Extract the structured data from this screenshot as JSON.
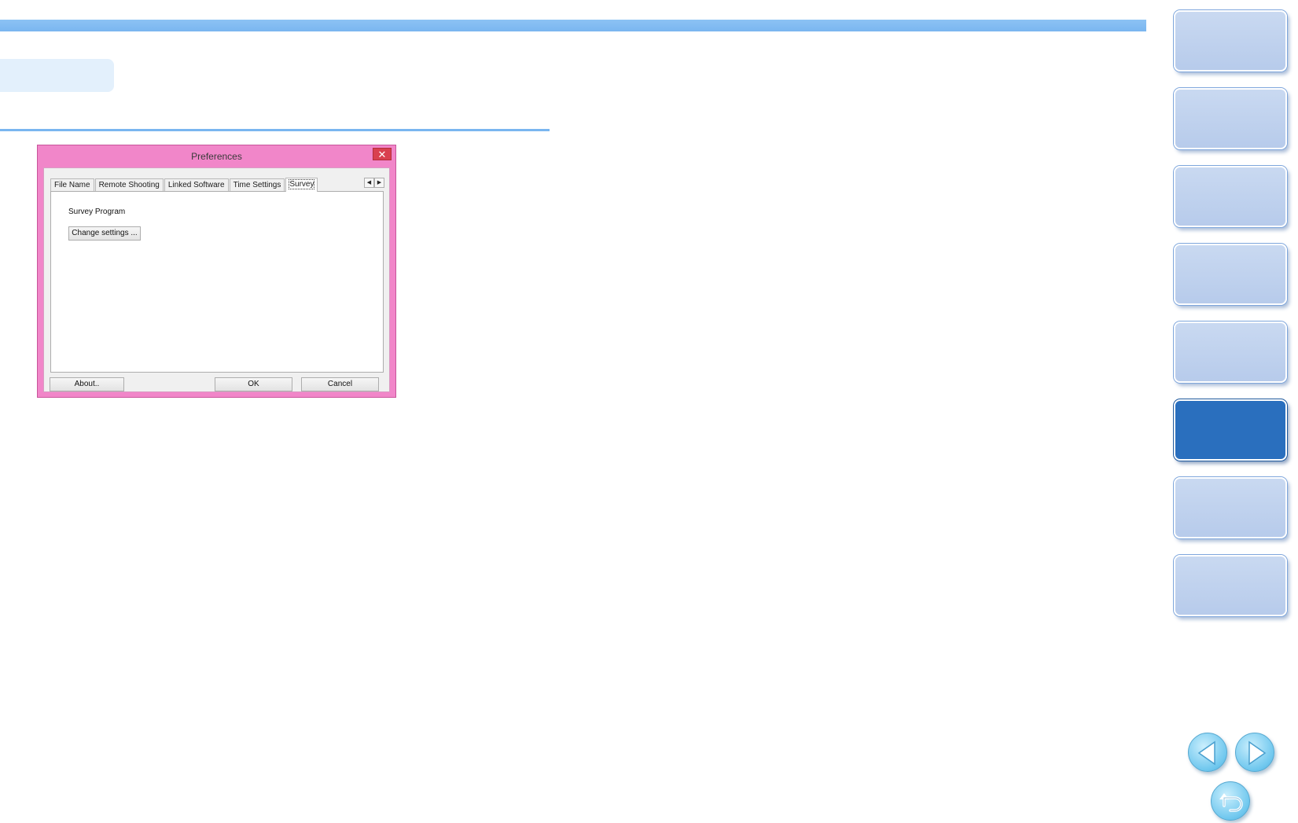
{
  "dialog": {
    "title": "Preferences",
    "close_glyph": "✕",
    "tabs": [
      {
        "label": "File Name"
      },
      {
        "label": "Remote Shooting"
      },
      {
        "label": "Linked Software"
      },
      {
        "label": "Time Settings"
      },
      {
        "label": "Survey"
      }
    ],
    "active_tab": "Survey",
    "scroll_left_glyph": "◀",
    "scroll_right_glyph": "▶",
    "panel": {
      "group_label": "Survey Program",
      "change_button": "Change settings ..."
    },
    "footer": {
      "about_button": "About..",
      "ok_button": "OK",
      "cancel_button": "Cancel"
    }
  },
  "sidebar": {
    "tab_count": 8,
    "active_index": 5
  },
  "colors": {
    "accent": "#7ab6f0",
    "dialog_frame": "#f186c9",
    "nav_active": "#2a6fbe",
    "nav_inactive": "#c9d9f1"
  },
  "icons": {
    "prev": "triangle-left-icon",
    "next": "triangle-right-icon",
    "return": "return-arrow-icon"
  }
}
